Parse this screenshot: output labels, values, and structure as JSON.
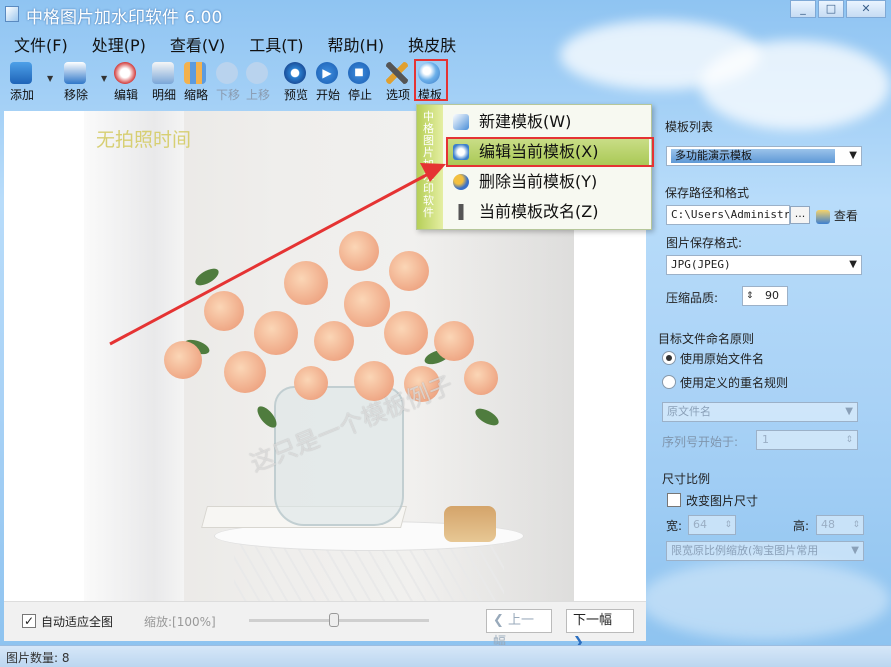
{
  "window": {
    "title": "中格图片加水印软件 6.00",
    "minimize": "_",
    "maximize": "□",
    "close": "✕"
  },
  "menu": [
    "文件(F)",
    "处理(P)",
    "查看(V)",
    "工具(T)",
    "帮助(H)",
    "换皮肤"
  ],
  "toolbar": {
    "add": "添加",
    "remove": "移除",
    "edit": "编辑",
    "detail": "明细",
    "thumb": "缩略",
    "move_down": "下移",
    "move_up": "上移",
    "preview": "预览",
    "start": "开始",
    "stop": "停止",
    "options": "选项",
    "template": "模板"
  },
  "template_menu": {
    "side_label": "中格图片加水印软件",
    "items": [
      "新建模板(W)",
      "编辑当前模板(X)",
      "删除当前模板(Y)",
      "当前模板改名(Z)"
    ]
  },
  "preview": {
    "date_text": "无拍照时间",
    "watermark_text": "这只是一个模板例子"
  },
  "bottom": {
    "auto_fit_label": "自动适应全图",
    "auto_fit_checked": "✓",
    "zoom_label": "缩放:[100%]",
    "prev_label": "上一幅",
    "prev_icon": "❮",
    "next_label": "下一幅",
    "next_icon": "❯"
  },
  "status": {
    "text": "图片数量: 8"
  },
  "panel": {
    "template_list_label": "模板列表",
    "template_selected": "多功能演示模板",
    "save_path_label": "保存路径和格式",
    "save_path_value": "C:\\Users\\Administrat",
    "browse_label": "...",
    "view_label": "查看",
    "format_label": "图片保存格式:",
    "format_value": "JPG(JPEG)",
    "quality_label": "压缩品质:",
    "quality_value": "90",
    "naming_label": "目标文件命名原则",
    "naming_original": "使用原始文件名",
    "naming_custom": "使用定义的重名规则",
    "orig_filename": "原文件名",
    "seq_label": "序列号开始于:",
    "seq_value": "1",
    "size_group_label": "尺寸比例",
    "resize_label": "改变图片尺寸",
    "width_label": "宽:",
    "width_value": "64",
    "height_label": "高:",
    "height_value": "48",
    "scale_mode": "限宽原比例缩放(淘宝图片常用"
  },
  "colors": {
    "highlight_red": "#e53333",
    "menu_green": "#aac956"
  }
}
